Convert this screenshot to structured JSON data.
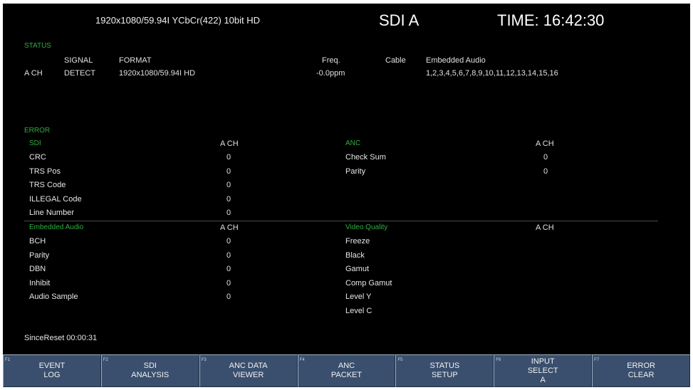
{
  "header": {
    "format": "1920x1080/59.94I YCbCr(422) 10bit HD",
    "input": "SDI A",
    "time": "TIME: 16:42:30"
  },
  "status": {
    "title": "STATUS",
    "col_signal": "SIGNAL",
    "col_format": "FORMAT",
    "col_freq": "Freq.",
    "col_cable": "Cable",
    "col_audio": "Embedded Audio",
    "channel": "A CH",
    "signal": "DETECT",
    "format": "1920x1080/59.94I HD",
    "freq": "-0.0ppm",
    "audio": "1,2,3,4,5,6,7,8,9,10,11,12,13,14,15,16"
  },
  "error": {
    "title": "ERROR",
    "sdi": {
      "title": "SDI",
      "col": "A CH",
      "rows": [
        {
          "label": "CRC",
          "value": "0"
        },
        {
          "label": "TRS Pos",
          "value": "0"
        },
        {
          "label": "TRS Code",
          "value": "0"
        },
        {
          "label": "ILLEGAL Code",
          "value": "0"
        },
        {
          "label": "Line Number",
          "value": "0"
        }
      ]
    },
    "anc": {
      "title": "ANC",
      "col": "A CH",
      "rows": [
        {
          "label": "Check Sum",
          "value": "0"
        },
        {
          "label": "Parity",
          "value": "0"
        }
      ]
    },
    "audio": {
      "title": "Embedded Audio",
      "col": "A CH",
      "rows": [
        {
          "label": "BCH",
          "value": "0"
        },
        {
          "label": "Parity",
          "value": "0"
        },
        {
          "label": "DBN",
          "value": "0"
        },
        {
          "label": "Inhibit",
          "value": "0"
        },
        {
          "label": "Audio Sample",
          "value": "0"
        }
      ]
    },
    "video": {
      "title": "Video Quality",
      "col": "A CH",
      "rows": [
        {
          "label": "Freeze"
        },
        {
          "label": "Black"
        },
        {
          "label": "Gamut"
        },
        {
          "label": "Comp Gamut"
        },
        {
          "label": "Level Y"
        },
        {
          "label": "Level C"
        }
      ]
    }
  },
  "since_reset": "SinceReset 00:00:31",
  "fkeys": [
    {
      "fn": "F1",
      "line1": "EVENT",
      "line2": "LOG",
      "line3": ""
    },
    {
      "fn": "F2",
      "line1": "SDI",
      "line2": "ANALYSIS",
      "line3": ""
    },
    {
      "fn": "F3",
      "line1": "ANC DATA",
      "line2": "VIEWER",
      "line3": ""
    },
    {
      "fn": "F4",
      "line1": "ANC",
      "line2": "PACKET",
      "line3": ""
    },
    {
      "fn": "F5",
      "line1": "STATUS",
      "line2": "SETUP",
      "line3": ""
    },
    {
      "fn": "F6",
      "line1": "INPUT",
      "line2": "SELECT",
      "line3": "A"
    },
    {
      "fn": "F7",
      "line1": "ERROR",
      "line2": "CLEAR",
      "line3": ""
    }
  ]
}
